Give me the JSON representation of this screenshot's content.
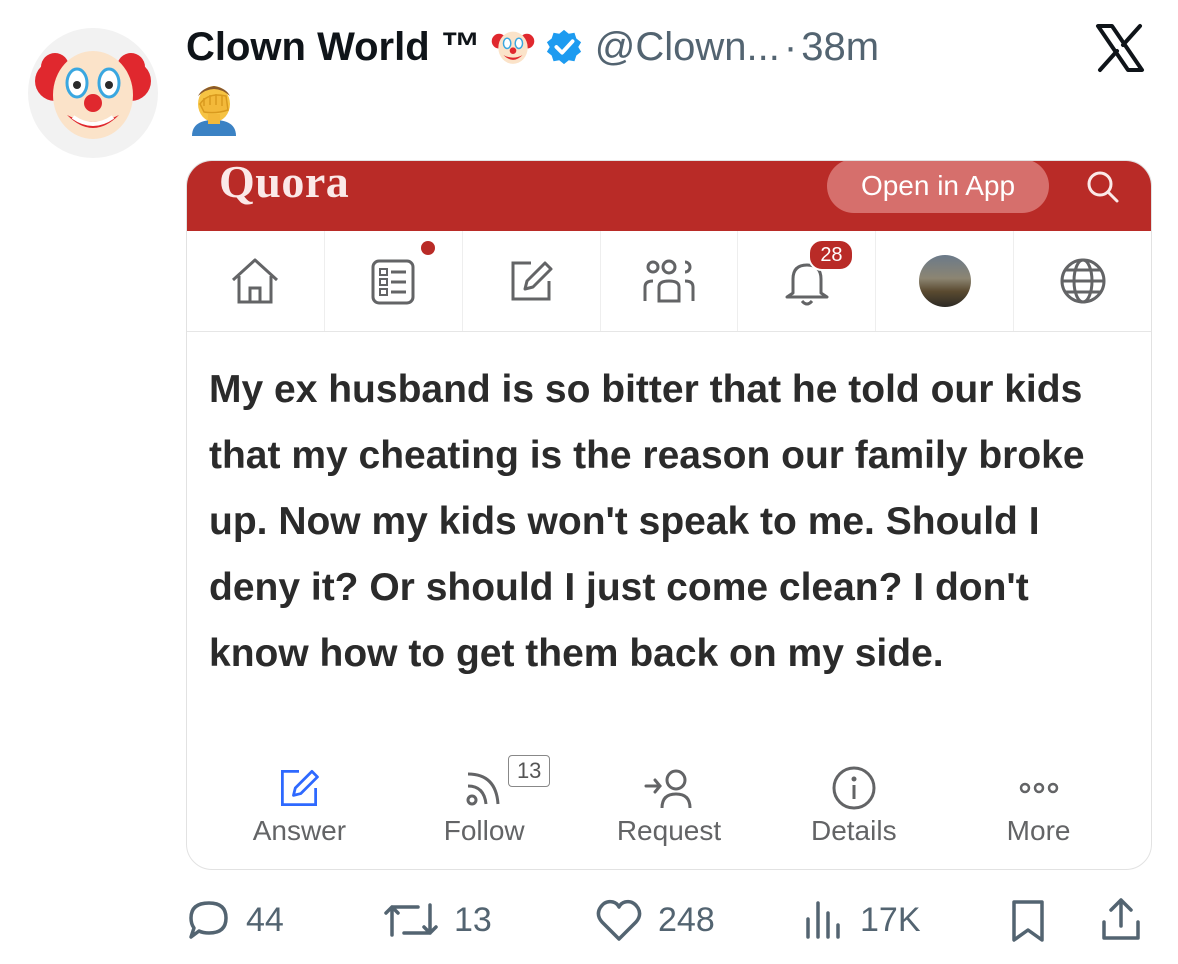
{
  "tweet": {
    "author_name": "Clown World ™",
    "handle": "@Clown...",
    "separator": "·",
    "time": "38m",
    "emoji_text": "🤦‍♂️",
    "accent_color": "#1d9bf0"
  },
  "embed": {
    "brand": "Quora",
    "brand_color": "#b92b27",
    "open_in_app": "Open in App",
    "nav": {
      "notifications_count": "28",
      "icons": [
        "home-icon",
        "feed-icon",
        "write-icon",
        "spaces-icon",
        "bell-icon",
        "profile-avatar",
        "globe-icon"
      ]
    },
    "question": "My ex husband is so bitter that he told our kids that my cheating is the reason our family broke up. Now my kids won't speak to me. Should I deny it? Or should I just come clean? I don't know how to get them back on my side.",
    "actions": {
      "answer": "Answer",
      "follow": "Follow",
      "follow_count": "13",
      "request": "Request",
      "details": "Details",
      "more": "More"
    }
  },
  "footer": {
    "replies": "44",
    "reposts": "13",
    "likes": "248",
    "views": "17K"
  }
}
